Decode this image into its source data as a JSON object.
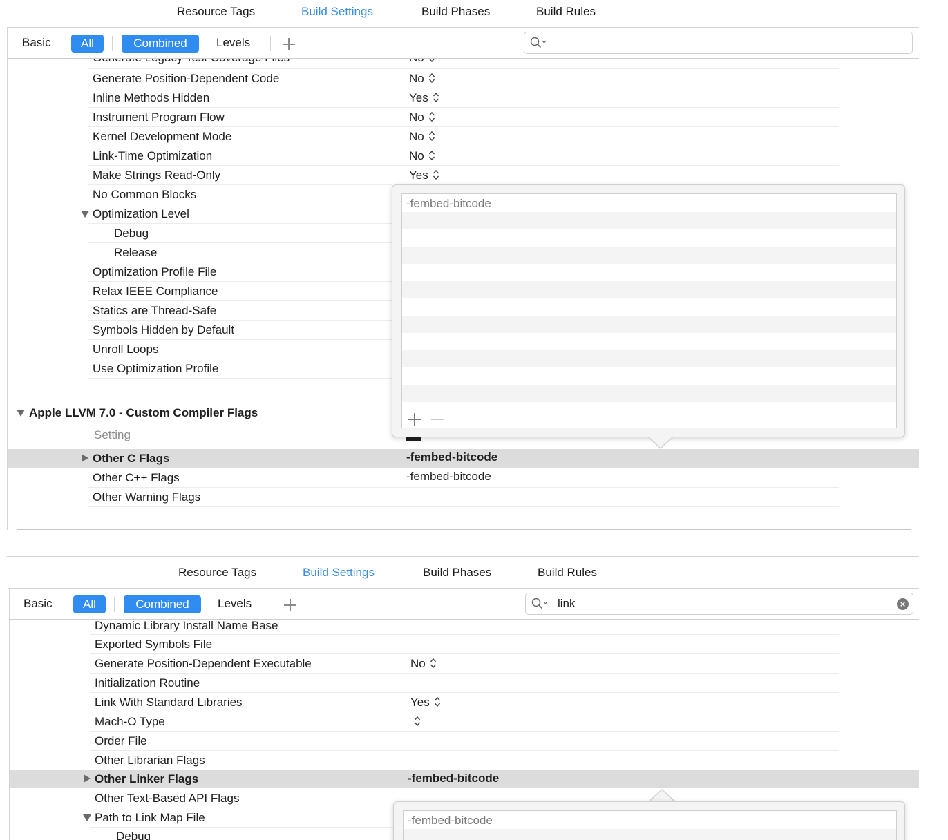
{
  "top_panel": {
    "tabs": [
      {
        "label": "Resource Tags"
      },
      {
        "label": "Build Settings",
        "active": true
      },
      {
        "label": "Build Phases"
      },
      {
        "label": "Build Rules"
      }
    ],
    "scope_bar": {
      "basic": "Basic",
      "all": "All",
      "combined": "Combined",
      "levels": "Levels",
      "search_value": ""
    },
    "rows": [
      {
        "label": "Generate Legacy Test Coverage Files",
        "value": "No"
      },
      {
        "label": "Generate Position-Dependent Code",
        "value": "No"
      },
      {
        "label": "Inline Methods Hidden",
        "value": "Yes"
      },
      {
        "label": "Instrument Program Flow",
        "value": "No"
      },
      {
        "label": "Kernel Development Mode",
        "value": "No"
      },
      {
        "label": "Link-Time Optimization",
        "value": "No"
      },
      {
        "label": "Make Strings Read-Only",
        "value": "Yes"
      },
      {
        "label": "No Common Blocks",
        "value": ""
      },
      {
        "label": "Optimization Level",
        "value": ""
      },
      {
        "label": "Debug",
        "value": ""
      },
      {
        "label": "Release",
        "value": ""
      },
      {
        "label": "Optimization Profile File",
        "value": ""
      },
      {
        "label": "Relax IEEE Compliance",
        "value": ""
      },
      {
        "label": "Statics are Thread-Safe",
        "value": ""
      },
      {
        "label": "Symbols Hidden by Default",
        "value": ""
      },
      {
        "label": "Unroll Loops",
        "value": ""
      },
      {
        "label": "Use Optimization Profile",
        "value": ""
      }
    ],
    "section": {
      "title": "Apple LLVM 7.0 - Custom Compiler Flags",
      "setting_header": "Setting",
      "rows": [
        {
          "label": "Other C Flags",
          "value": "-fembed-bitcode"
        },
        {
          "label": "Other C++ Flags",
          "value": "-fembed-bitcode"
        },
        {
          "label": "Other Warning Flags",
          "value": ""
        }
      ]
    },
    "popover": {
      "entries": [
        "-fembed-bitcode"
      ]
    }
  },
  "bottom_panel": {
    "tabs": [
      {
        "label": "Resource Tags"
      },
      {
        "label": "Build Settings",
        "active": true
      },
      {
        "label": "Build Phases"
      },
      {
        "label": "Build Rules"
      }
    ],
    "scope_bar": {
      "basic": "Basic",
      "all": "All",
      "combined": "Combined",
      "levels": "Levels",
      "search_value": "link"
    },
    "rows": [
      {
        "label": "Dynamic Library Install Name Base",
        "value": ""
      },
      {
        "label": "Exported Symbols File",
        "value": ""
      },
      {
        "label": "Generate Position-Dependent Executable",
        "value": "No"
      },
      {
        "label": "Initialization Routine",
        "value": ""
      },
      {
        "label": "Link With Standard Libraries",
        "value": "Yes"
      },
      {
        "label": "Mach-O Type",
        "value": ""
      },
      {
        "label": "Order File",
        "value": ""
      },
      {
        "label": "Other Librarian Flags",
        "value": ""
      },
      {
        "label": "Other Linker Flags",
        "value": "-fembed-bitcode"
      },
      {
        "label": "Other Text-Based API Flags",
        "value": ""
      },
      {
        "label": "Path to Link Map File",
        "value": ""
      },
      {
        "label": "Debug",
        "value": ""
      }
    ],
    "popover": {
      "entries": [
        "-fembed-bitcode"
      ]
    }
  }
}
